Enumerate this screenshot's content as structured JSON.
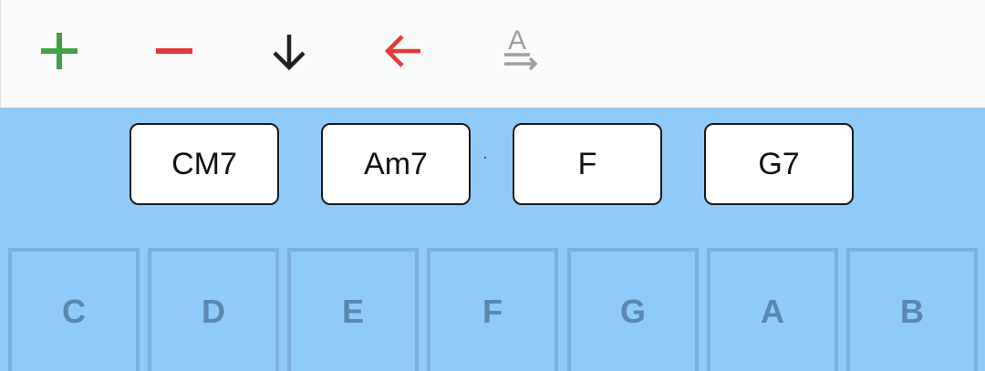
{
  "toolbar": {
    "add": {
      "icon": "plus-icon",
      "color": "#43a047"
    },
    "remove": {
      "icon": "minus-icon",
      "color": "#e53935"
    },
    "down": {
      "icon": "arrow-down-icon",
      "color": "#212121"
    },
    "back": {
      "icon": "arrow-left-icon",
      "color": "#e53935"
    },
    "text": {
      "icon": "text-direction-icon",
      "color": "#9e9e9e",
      "letter": "A"
    }
  },
  "chords": [
    "CM7",
    "Am7",
    "F",
    "G7"
  ],
  "keys": [
    "C",
    "D",
    "E",
    "F",
    "G",
    "A",
    "B"
  ],
  "colors": {
    "background": "#90caf9",
    "toolbar": "#fafafa",
    "key_border": "#7eb0db",
    "key_text": "#5b86ae"
  }
}
